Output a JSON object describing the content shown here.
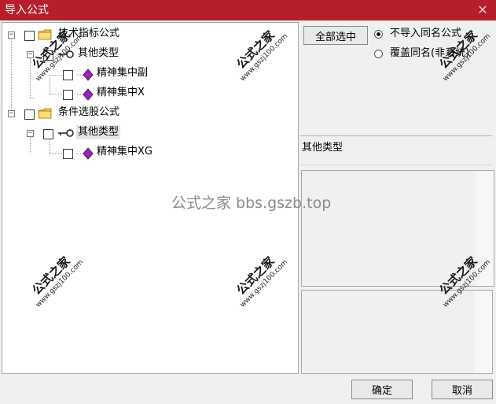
{
  "window": {
    "title": "导入公式",
    "close_glyph": "✕"
  },
  "tree": {
    "nodes": [
      {
        "label": "技术指标公式",
        "icon": "folder-icon"
      },
      {
        "label": "其他类型",
        "icon": "key-icon"
      },
      {
        "label": "精神集中副",
        "icon": "purple-diamond-icon"
      },
      {
        "label": "精神集中X",
        "icon": "purple-diamond-icon"
      },
      {
        "label": "条件选股公式",
        "icon": "folder-icon"
      },
      {
        "label": "其他类型",
        "icon": "key-icon"
      },
      {
        "label": "精神集中XG",
        "icon": "purple-diamond-icon"
      }
    ]
  },
  "right": {
    "select_all": "全部选中",
    "radio_no_import": "不导入同名公式",
    "radio_overwrite": "覆盖同名(非系统)",
    "info_text": "其他类型"
  },
  "footer": {
    "ok": "确定",
    "cancel": "取消"
  },
  "watermark": {
    "center_text": "公式之家 bbs.gszb.top",
    "stamp_text": "公式之家",
    "stamp_url": "www.gszj100.com"
  },
  "colors": {
    "title_bar": "#b61e2b",
    "folder": "#f3c94a",
    "diamond": "#9b27b5"
  }
}
